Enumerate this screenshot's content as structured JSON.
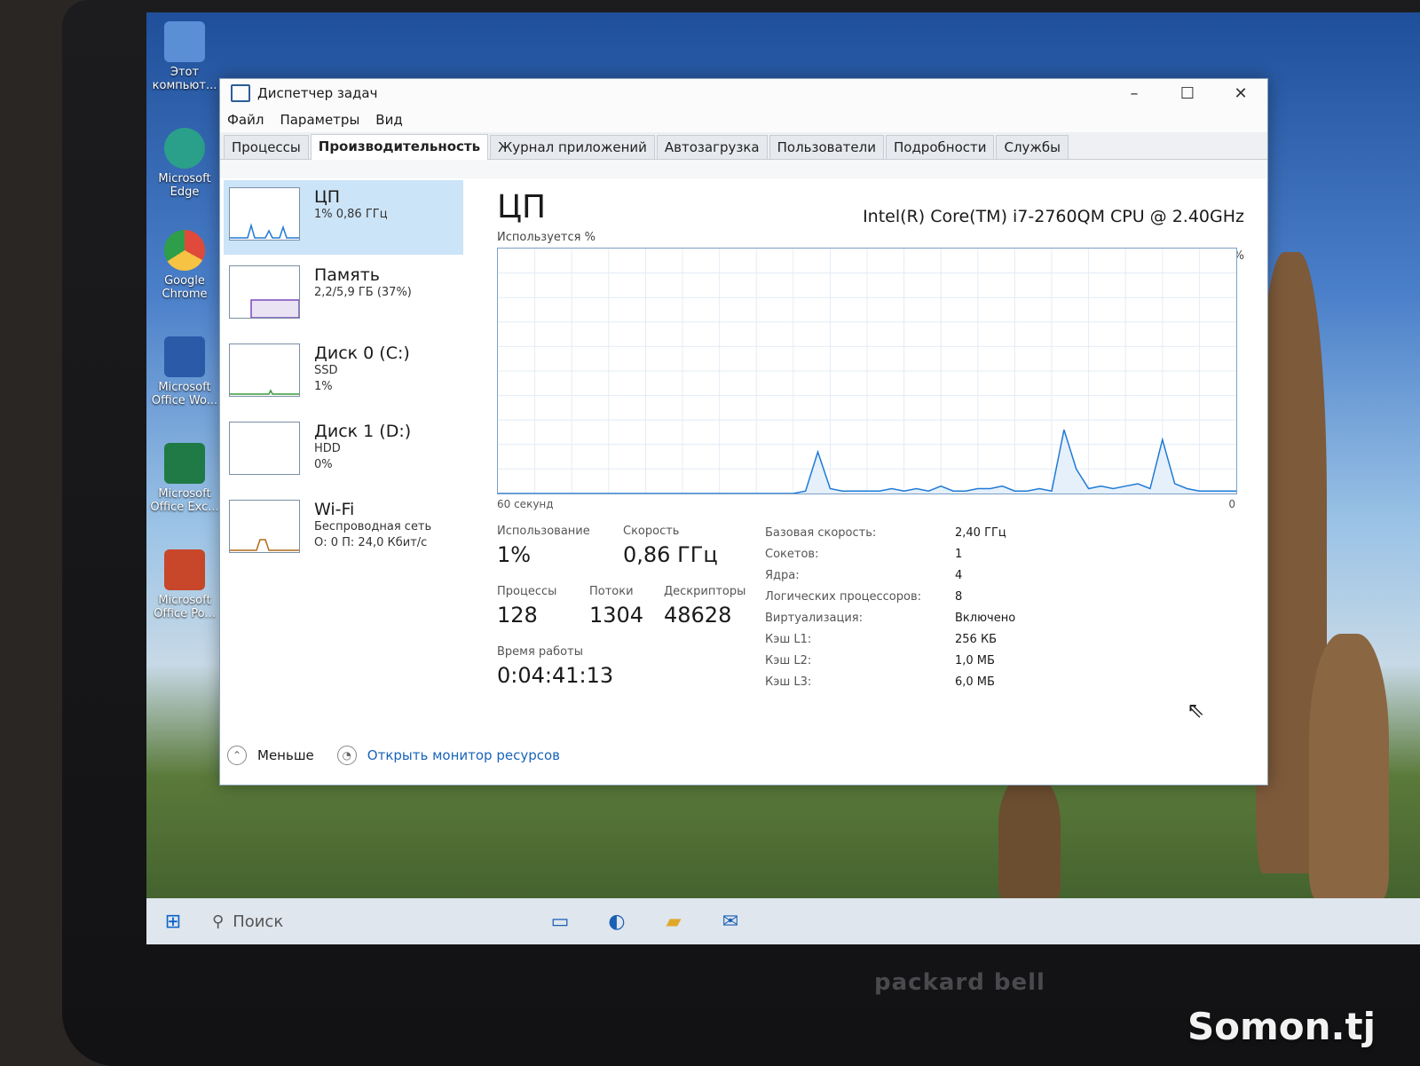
{
  "desktop": {
    "icons": [
      {
        "label": "Этот компьют...",
        "icon": "computer-icon",
        "color": "#5a8fd6"
      },
      {
        "label": "Microsoft Edge",
        "icon": "edge-icon",
        "color": "#2a9f8a"
      },
      {
        "label": "Google Chrome",
        "icon": "chrome-icon",
        "color": "#e04a3a"
      },
      {
        "label": "Microsoft Office Wo...",
        "icon": "word-icon",
        "color": "#2b5aa8"
      },
      {
        "label": "Microsoft Office Exc...",
        "icon": "excel-icon",
        "color": "#1f7a45"
      },
      {
        "label": "Microsoft Office Po...",
        "icon": "powerpoint-icon",
        "color": "#c8462a"
      }
    ]
  },
  "window": {
    "title": "Диспетчер задач",
    "menu": [
      "Файл",
      "Параметры",
      "Вид"
    ],
    "tabs": [
      "Процессы",
      "Производительность",
      "Журнал приложений",
      "Автозагрузка",
      "Пользователи",
      "Подробности",
      "Службы"
    ],
    "active_tab": "Производительность"
  },
  "sidebar": [
    {
      "name": "ЦП",
      "line1": "1% 0,86 ГГц",
      "line2": ""
    },
    {
      "name": "Память",
      "line1": "2,2/5,9 ГБ (37%)",
      "line2": ""
    },
    {
      "name": "Диск 0 (C:)",
      "line1": "SSD",
      "line2": "1%"
    },
    {
      "name": "Диск 1 (D:)",
      "line1": "HDD",
      "line2": "0%"
    },
    {
      "name": "Wi-Fi",
      "line1": "Беспроводная сеть",
      "line2": "О: 0 П: 24,0 Кбит/с"
    }
  ],
  "cpu": {
    "heading": "ЦП",
    "model": "Intel(R) Core(TM) i7-2760QM CPU @ 2.40GHz",
    "util_label": "Используется %",
    "max_label": "100%",
    "time_label": "60 секунд",
    "zero_label": "0",
    "graph_values": [
      0,
      0,
      0,
      0,
      0,
      0,
      0,
      0,
      0,
      0,
      0,
      0,
      0,
      0,
      0,
      0,
      0,
      0,
      0,
      0,
      0,
      0,
      0,
      0,
      0,
      1,
      17,
      2,
      1,
      1,
      1,
      1,
      2,
      1,
      2,
      1,
      3,
      1,
      1,
      2,
      2,
      3,
      1,
      1,
      2,
      1,
      26,
      10,
      2,
      3,
      2,
      3,
      4,
      2,
      22,
      4,
      2,
      1,
      1,
      1,
      1
    ],
    "usage_label": "Использование",
    "usage": "1%",
    "speed_label": "Скорость",
    "speed": "0,86 ГГц",
    "processes_label": "Процессы",
    "processes": "128",
    "threads_label": "Потоки",
    "threads": "1304",
    "handles_label": "Дескрипторы",
    "handles": "48628",
    "uptime_label": "Время работы",
    "uptime": "0:04:41:13",
    "specs": [
      {
        "k": "Базовая скорость:",
        "v": "2,40 ГГц"
      },
      {
        "k": "Сокетов:",
        "v": "1"
      },
      {
        "k": "Ядра:",
        "v": "4"
      },
      {
        "k": "Логических процессоров:",
        "v": "8"
      },
      {
        "k": "Виртуализация:",
        "v": "Включено"
      },
      {
        "k": "Кэш L1:",
        "v": "256 КБ"
      },
      {
        "k": "Кэш L2:",
        "v": "1,0 МБ"
      },
      {
        "k": "Кэш L3:",
        "v": "6,0 МБ"
      }
    ]
  },
  "footer": {
    "less": "Меньше",
    "monitor": "Открыть монитор ресурсов"
  },
  "taskbar": {
    "search": "Поиск"
  },
  "brand": "packard bell",
  "watermark": "Somon.tj",
  "colors": {
    "cpu_graph": "#1f7ad6",
    "selected_bg": "#cce4f7",
    "memory_graph": "#7a4ab8"
  }
}
